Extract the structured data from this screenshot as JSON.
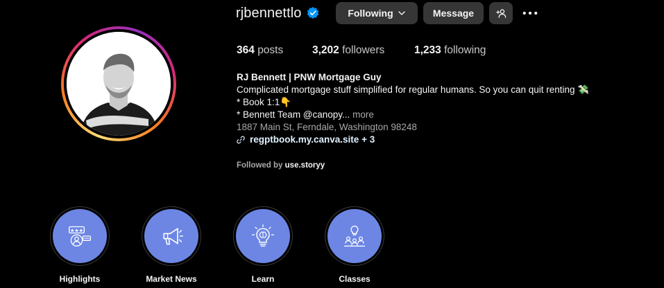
{
  "profile": {
    "username": "rjbennettlo",
    "verified": true
  },
  "actions": {
    "following_label": "Following",
    "message_label": "Message"
  },
  "stats": {
    "posts_count": "364",
    "posts_label": "posts",
    "followers_count": "3,202",
    "followers_label": "followers",
    "following_count": "1,233",
    "following_label": "following"
  },
  "bio": {
    "name": "RJ Bennett | PNW Mortgage Guy",
    "line1": "Complicated mortgage stuff simplified for regular humans. So you can quit renting 💸",
    "line2": "* Book 1:1👇",
    "line3": "* Bennett Team @canopy...",
    "more": "more",
    "address": "1887 Main St, Ferndale, Washington 98248",
    "link": "regptbook.my.canva.site",
    "link_extra": "+ 3"
  },
  "followed_by": {
    "prefix": "Followed by",
    "user": "use.storyy"
  },
  "highlights": [
    {
      "label": "Highlights",
      "icon": "review-stars-icon"
    },
    {
      "label": "Market News",
      "icon": "megaphone-icon"
    },
    {
      "label": "Learn",
      "icon": "lightbulb-brain-icon"
    },
    {
      "label": "Classes",
      "icon": "classroom-icon"
    }
  ],
  "colors": {
    "background": "#000000",
    "button": "#363636",
    "verified": "#0095f6",
    "highlight_fill": "#6d86e4",
    "muted_text": "#a8a8a8"
  }
}
